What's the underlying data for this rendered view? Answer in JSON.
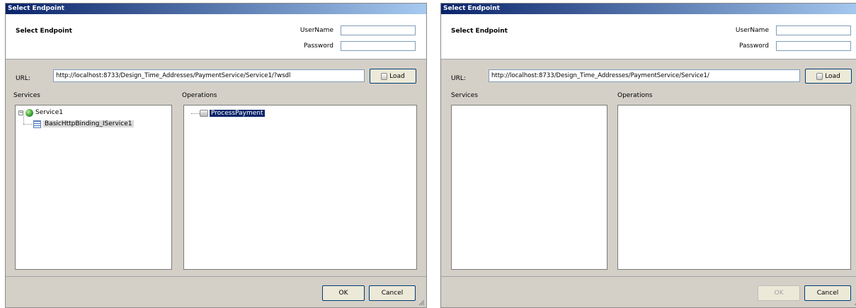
{
  "dialogs": [
    {
      "title": "Select Endpoint",
      "header_title": "Select Endpoint",
      "username_label": "UserName",
      "username_value": "",
      "password_label": "Password",
      "password_value": "",
      "url_label": "URL:",
      "url_value": "http://localhost:8733/Design_Time_Addresses/PaymentService/Service1/?wsdl",
      "load_label": "Load",
      "services_label": "Services",
      "operations_label": "Operations",
      "tree": {
        "service": "Service1",
        "binding": "BasicHttpBinding_IService1"
      },
      "operations": [
        "ProcessPayment"
      ],
      "ok_label": "OK",
      "ok_enabled": true,
      "cancel_label": "Cancel"
    },
    {
      "title": "Select Endpoint",
      "header_title": "Select Endpoint",
      "username_label": "UserName",
      "username_value": "",
      "password_label": "Password",
      "password_value": "",
      "url_label": "URL:",
      "url_value": "http://localhost:8733/Design_Time_Addresses/PaymentService/Service1/",
      "load_label": "Load",
      "services_label": "Services",
      "operations_label": "Operations",
      "ok_label": "OK",
      "ok_enabled": false,
      "cancel_label": "Cancel"
    }
  ],
  "colors": {
    "titlebar_start": "#0a246a",
    "titlebar_end": "#a6caf0",
    "dialog_bg": "#d4d0c8",
    "selection": "#0a246a"
  }
}
